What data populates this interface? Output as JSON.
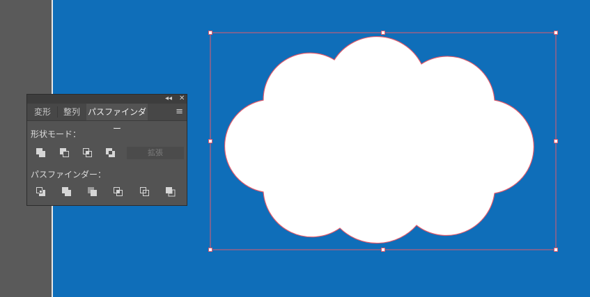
{
  "panel": {
    "tabs": [
      {
        "label": "変形"
      },
      {
        "label": "整列"
      },
      {
        "label": "パスファインダー"
      }
    ],
    "collapse_glyph": "◂◂",
    "close_glyph": "✕",
    "menu_glyph": "≡",
    "shape_modes_label": "形状モード：",
    "expand_label": "拡張",
    "pathfinders_label": "パスファインダー："
  },
  "colors": {
    "canvas": "#0f6eb9",
    "selection": "#e05a6b",
    "panel_bg": "#535353"
  }
}
